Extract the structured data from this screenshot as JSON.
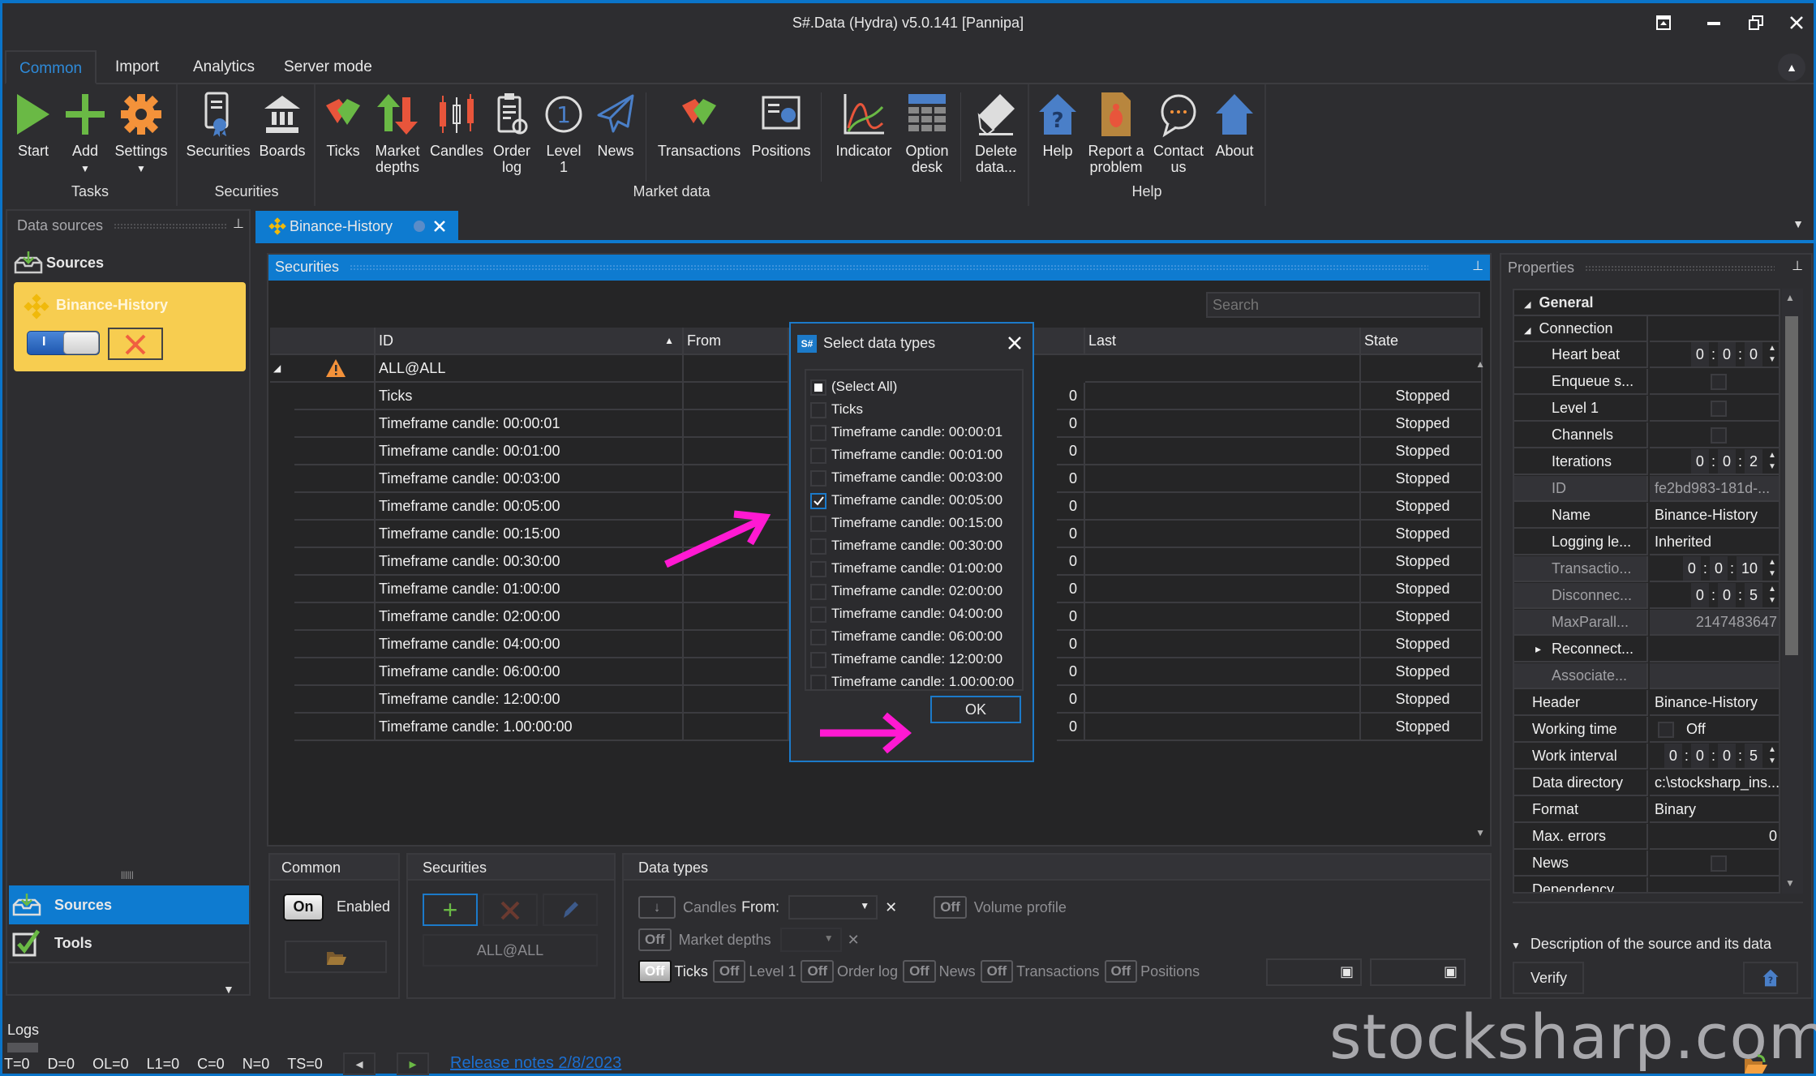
{
  "window": {
    "title": "S#.Data (Hydra) v5.0.141 [Pannipa]",
    "controls": [
      "restore-to-tray",
      "minimize",
      "maximize",
      "close"
    ]
  },
  "ribbon": {
    "tabs": [
      {
        "label": "Common",
        "active": true
      },
      {
        "label": "Import",
        "active": false
      },
      {
        "label": "Analytics",
        "active": false
      },
      {
        "label": "Server mode",
        "active": false
      }
    ],
    "groups": [
      {
        "label": "Tasks",
        "buttons": [
          {
            "label": "Start",
            "icon": "play-icon"
          },
          {
            "label": "Add",
            "icon": "plus-icon",
            "dropdown": true
          },
          {
            "label": "Settings",
            "icon": "gear-icon",
            "dropdown": true
          }
        ]
      },
      {
        "label": "Securities",
        "buttons": [
          {
            "label": "Securities",
            "icon": "certificate-icon"
          },
          {
            "label": "Boards",
            "icon": "bank-icon"
          }
        ]
      },
      {
        "label": "Market data",
        "buttons": [
          {
            "label": "Ticks",
            "icon": "handshake-icon"
          },
          {
            "label": "Market depths",
            "line1": "Market",
            "line2": "depths",
            "icon": "up-down-arrows-icon"
          },
          {
            "label": "Candles",
            "icon": "candles-icon"
          },
          {
            "label": "Order log",
            "line1": "Order",
            "line2": "log",
            "icon": "clipboard-icon"
          },
          {
            "label": "Level 1",
            "line1": "Level",
            "line2": "1",
            "icon": "level1-icon"
          },
          {
            "label": "News",
            "icon": "paper-plane-icon"
          },
          {
            "label": "Transactions",
            "icon": "handshake-icon"
          },
          {
            "label": "Positions",
            "icon": "positions-icon"
          },
          {
            "label": "Indicator",
            "icon": "indicator-icon"
          },
          {
            "label": "Option desk",
            "line1": "Option",
            "line2": "desk",
            "icon": "option-desk-icon"
          }
        ]
      },
      {
        "label": "",
        "buttons": [
          {
            "label": "Delete data...",
            "line1": "Delete",
            "line2": "data...",
            "icon": "eraser-icon"
          }
        ]
      },
      {
        "label": "Help",
        "buttons": [
          {
            "label": "Help",
            "icon": "help-house-icon"
          },
          {
            "label": "Report a problem",
            "line1": "Report a",
            "line2": "problem",
            "icon": "bug-icon"
          },
          {
            "label": "Contact us",
            "line1": "Contact",
            "line2": "us",
            "icon": "chat-icon"
          },
          {
            "label": "About",
            "icon": "about-icon"
          }
        ]
      }
    ]
  },
  "left_panel": {
    "title": "Data sources",
    "sources_label": "Sources",
    "source_card": {
      "name": "Binance-History",
      "enabled": true,
      "toggle_label": "I"
    },
    "nav": [
      {
        "label": "Sources",
        "active": true
      },
      {
        "label": "Tools",
        "active": false
      }
    ]
  },
  "doc_tab": {
    "label": "Binance-History"
  },
  "securities_panel": {
    "title": "Securities",
    "search_placeholder": "Search",
    "columns": [
      "",
      "",
      "ID",
      "From",
      "",
      "Last",
      "State"
    ],
    "sort_indicator": "ascending",
    "group_row": {
      "id": "ALL@ALL",
      "warning": true
    },
    "rows": [
      {
        "id": "Ticks",
        "count": "0",
        "state": "Stopped"
      },
      {
        "id": "Timeframe candle: 00:00:01",
        "count": "0",
        "state": "Stopped"
      },
      {
        "id": "Timeframe candle: 00:01:00",
        "count": "0",
        "state": "Stopped"
      },
      {
        "id": "Timeframe candle: 00:03:00",
        "count": "0",
        "state": "Stopped"
      },
      {
        "id": "Timeframe candle: 00:05:00",
        "count": "0",
        "state": "Stopped"
      },
      {
        "id": "Timeframe candle: 00:15:00",
        "count": "0",
        "state": "Stopped"
      },
      {
        "id": "Timeframe candle: 00:30:00",
        "count": "0",
        "state": "Stopped"
      },
      {
        "id": "Timeframe candle: 01:00:00",
        "count": "0",
        "state": "Stopped"
      },
      {
        "id": "Timeframe candle: 02:00:00",
        "count": "0",
        "state": "Stopped"
      },
      {
        "id": "Timeframe candle: 04:00:00",
        "count": "0",
        "state": "Stopped"
      },
      {
        "id": "Timeframe candle: 06:00:00",
        "count": "0",
        "state": "Stopped"
      },
      {
        "id": "Timeframe candle: 12:00:00",
        "count": "0",
        "state": "Stopped"
      },
      {
        "id": "Timeframe candle: 1.00:00:00",
        "count": "0",
        "state": "Stopped"
      }
    ]
  },
  "dialog": {
    "title": "Select data types",
    "items": [
      {
        "label": "(Select All)",
        "state": "indeterminate"
      },
      {
        "label": "Ticks",
        "state": "unchecked"
      },
      {
        "label": "Timeframe candle: 00:00:01",
        "state": "unchecked"
      },
      {
        "label": "Timeframe candle: 00:01:00",
        "state": "unchecked"
      },
      {
        "label": "Timeframe candle: 00:03:00",
        "state": "unchecked"
      },
      {
        "label": "Timeframe candle: 00:05:00",
        "state": "checked"
      },
      {
        "label": "Timeframe candle: 00:15:00",
        "state": "unchecked"
      },
      {
        "label": "Timeframe candle: 00:30:00",
        "state": "unchecked"
      },
      {
        "label": "Timeframe candle: 01:00:00",
        "state": "unchecked"
      },
      {
        "label": "Timeframe candle: 02:00:00",
        "state": "unchecked"
      },
      {
        "label": "Timeframe candle: 04:00:00",
        "state": "unchecked"
      },
      {
        "label": "Timeframe candle: 06:00:00",
        "state": "unchecked"
      },
      {
        "label": "Timeframe candle: 12:00:00",
        "state": "unchecked"
      },
      {
        "label": "Timeframe candle: 1.00:00:00",
        "state": "unchecked"
      }
    ],
    "ok_label": "OK"
  },
  "bottom": {
    "common": {
      "title": "Common",
      "toggle": "On",
      "enabled_label": "Enabled"
    },
    "securities": {
      "title": "Securities",
      "security": "ALL@ALL"
    },
    "data_types": {
      "title": "Data types",
      "candles_label": "Candles",
      "from_label": "From:",
      "volume_profile_toggle": "Off",
      "volume_profile_label": "Volume profile",
      "market_depths_toggle": "Off",
      "market_depths_label": "Market depths",
      "row3": [
        {
          "toggle": "Off",
          "label": "Ticks"
        },
        {
          "toggle": "Off",
          "label": "Level 1"
        },
        {
          "toggle": "Off",
          "label": "Order log"
        },
        {
          "toggle": "Off",
          "label": "News"
        },
        {
          "toggle": "Off",
          "label": "Transactions"
        },
        {
          "toggle": "Off",
          "label": "Positions"
        }
      ]
    }
  },
  "properties": {
    "title": "Properties",
    "category": "General",
    "subcategory": "Connection",
    "rows": [
      {
        "key": "Heart beat",
        "value": "0 : 0 : 0",
        "type": "spin",
        "parts": [
          "0",
          "0",
          "0"
        ]
      },
      {
        "key": "Enqueue s...",
        "type": "checkbox",
        "checked": false
      },
      {
        "key": "Level 1",
        "type": "checkbox",
        "checked": false
      },
      {
        "key": "Channels",
        "type": "checkbox",
        "checked": false
      },
      {
        "key": "Iterations",
        "type": "spin",
        "parts": [
          "0",
          "0",
          "2"
        ]
      },
      {
        "key": "ID",
        "value": "fe2bd983-181d-...",
        "type": "text",
        "dim": true
      },
      {
        "key": "Name",
        "value": "Binance-History",
        "type": "text"
      },
      {
        "key": "Logging le...",
        "value": "Inherited",
        "type": "text"
      },
      {
        "key": "Transactio...",
        "type": "spin",
        "parts": [
          "0",
          "0",
          "10"
        ],
        "dim": true
      },
      {
        "key": "Disconnec...",
        "type": "spin",
        "parts": [
          "0",
          "0",
          "5"
        ],
        "dim": true
      },
      {
        "key": "MaxParall...",
        "value": "2147483647",
        "type": "number",
        "dim": true
      },
      {
        "key": "Reconnect...",
        "type": "expander"
      },
      {
        "key": "Associate...",
        "type": "text",
        "value": "",
        "dim": true
      },
      {
        "key": "Header",
        "value": "Binance-History",
        "type": "text",
        "top": true
      },
      {
        "key": "Working time",
        "value": "Off",
        "type": "checkbox-text",
        "top": true
      },
      {
        "key": "Work interval",
        "type": "spin4",
        "parts": [
          "0",
          "0",
          "0",
          "5"
        ],
        "top": true
      },
      {
        "key": "Data directory",
        "value": "c:\\stocksharp_ins...",
        "type": "text",
        "top": true
      },
      {
        "key": "Format",
        "value": "Binary",
        "type": "text",
        "top": true
      },
      {
        "key": "Max. errors",
        "value": "0",
        "type": "number",
        "top": true
      },
      {
        "key": "News",
        "type": "checkbox",
        "top": true
      },
      {
        "key": "Dependency",
        "type": "text",
        "value": "",
        "top": true
      }
    ],
    "description_label": "Description of the source and its data",
    "verify_label": "Verify"
  },
  "logs": {
    "title": "Logs",
    "counters": [
      "T=0",
      "D=0",
      "OL=0",
      "L1=0",
      "C=0",
      "N=0",
      "TS=0"
    ],
    "release_notes": "Release notes 2/8/2023"
  },
  "watermark": "stocksharp.com",
  "colors": {
    "accent": "#007acc",
    "card": "#f7cd50",
    "annotation": "#ff19d2"
  }
}
